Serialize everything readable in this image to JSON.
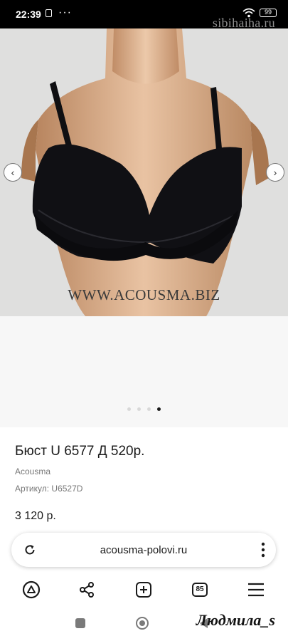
{
  "status_bar": {
    "time": "22:39",
    "more": "···",
    "battery": "99",
    "watermark": "sibihaiha.ru"
  },
  "product_image": {
    "overlay_url": "WWW.ACOUSMA.BIZ",
    "prev_icon": "chevron-left-icon",
    "next_icon": "chevron-right-icon",
    "slides_total": 4,
    "active_slide": 4
  },
  "product": {
    "title": "Бюст U 6577 Д 520р.",
    "brand": "Acousma",
    "sku": "Артикул: U6527D",
    "price": "3 120 р."
  },
  "address_bar": {
    "url": "acousma-polovi.ru",
    "reload_icon": "reload-icon",
    "menu_icon": "more-vertical-icon"
  },
  "toolbar": {
    "items": [
      {
        "name": "alice-icon"
      },
      {
        "name": "share-icon"
      },
      {
        "name": "new-tab-icon"
      },
      {
        "name": "tabs-count-icon",
        "count": "85"
      },
      {
        "name": "menu-icon"
      }
    ]
  },
  "system_nav": {
    "signature": "Людмила_s"
  },
  "colors": {
    "status_bar_bg": "#000000",
    "photo_bg": "#dfdfde",
    "text_primary": "#1a1a1a",
    "text_secondary": "#777777"
  }
}
